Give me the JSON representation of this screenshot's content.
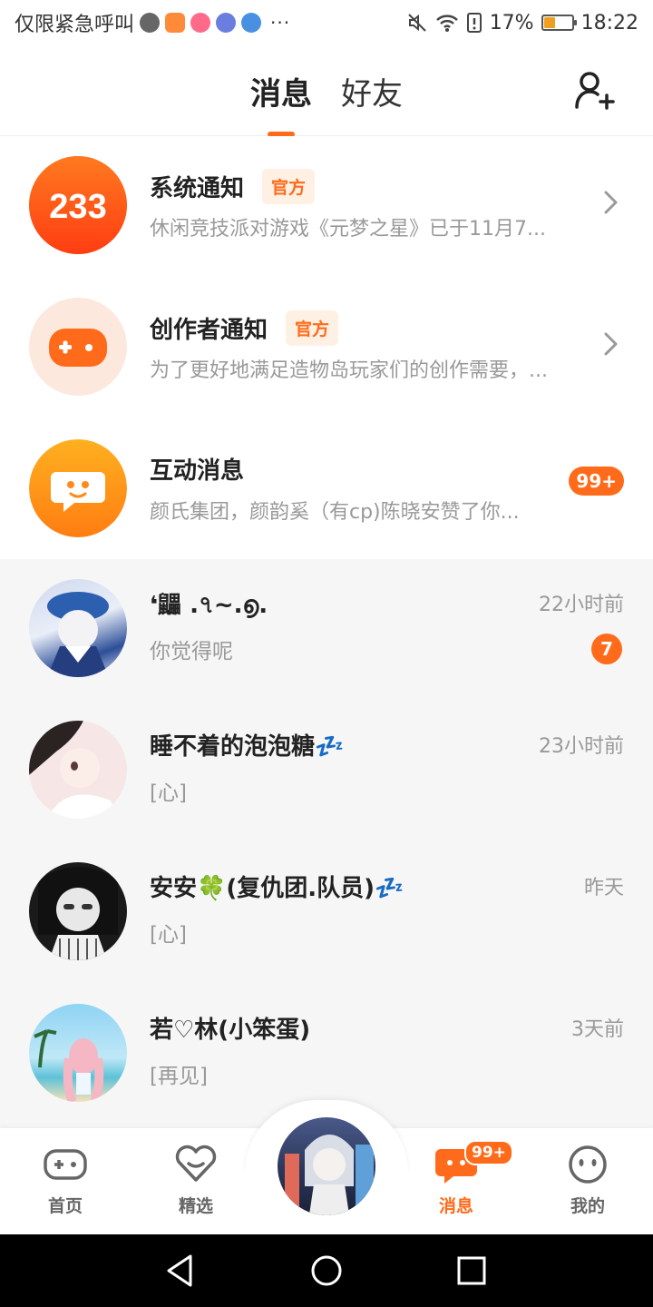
{
  "status_bar": {
    "carrier": "仅限紧急呼叫",
    "dots": "···",
    "battery": "17%",
    "time": "18:22"
  },
  "header": {
    "tabs": [
      {
        "label": "消息",
        "active": true
      },
      {
        "label": "好友",
        "active": false
      }
    ],
    "add_friend_icon": "add-person-icon"
  },
  "notices": [
    {
      "title": "系统通知",
      "tag": "官方",
      "desc": "休闲竞技派对游戏《元梦之星》已于11月7...",
      "avatar_text": "233",
      "avatar_color": "#ff5a1a"
    },
    {
      "title": "创作者通知",
      "tag": "官方",
      "desc": "为了更好地满足造物岛玩家们的创作需要，...",
      "avatar_color": "#fde8de"
    },
    {
      "title": "互动消息",
      "desc": "颜氏集团，颜韵奚（有cp)陈晓安赞了你...",
      "count": "99+",
      "avatar_color": "#ff9a1a"
    }
  ],
  "chats": [
    {
      "name": "❛鼺 .৭~.൭.",
      "msg": "你觉得呢",
      "time": "22小时前",
      "unread": "7"
    },
    {
      "name": "睡不着的泡泡糖💤",
      "msg": "[心]",
      "time": "23小时前"
    },
    {
      "name": "安安🍀(复仇团.队员)💤",
      "msg": "[心]",
      "time": "昨天"
    },
    {
      "name": "若♡林(小笨蛋)",
      "msg": "[再见]",
      "time": "3天前"
    }
  ],
  "bottom_nav": {
    "items": [
      {
        "label": "首页",
        "icon": "gamepad-icon"
      },
      {
        "label": "精选",
        "icon": "heart-icon"
      },
      {
        "label": "消息",
        "icon": "chat-bubble-icon",
        "badge": "99+",
        "active": true
      },
      {
        "label": "我的",
        "icon": "face-icon"
      }
    ]
  },
  "colors": {
    "accent": "#ff6b1a",
    "muted": "#999999",
    "chat_bg": "#f6f6f6"
  }
}
